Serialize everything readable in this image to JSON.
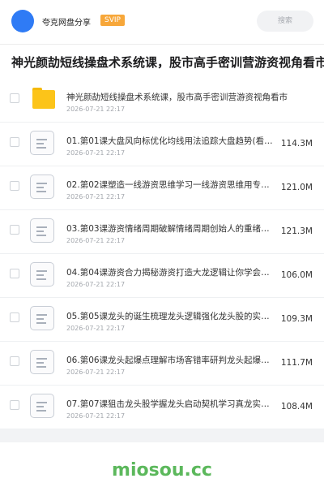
{
  "header": {
    "username": "夸克网盘分享",
    "badge": "SVIP",
    "search_placeholder": "搜索"
  },
  "page_title": "神光颜劼短线操盘术系统课，股市高手密训营游资视角看市",
  "items": [
    {
      "type": "folder",
      "name": "神光颜劼短线操盘术系统课，股市高手密训营游资视角看市",
      "date": "2026-07-21 22:17",
      "size": ""
    },
    {
      "type": "file",
      "name": "01.第01课大盘风向标优化均线用法追踪大盘趋势(看懂大盘风向)",
      "date": "2026-07-21 22:17",
      "size": "114.3M"
    },
    {
      "type": "file",
      "name": "02.第02课塑造一线游资思维学习一线游资思维用专业视角看盘",
      "date": "2026-07-21 22:17",
      "size": "121.0M"
    },
    {
      "type": "file",
      "name": "03.第03课游资情绪周期破解情绪周期创始人的重绪周期模型",
      "date": "2026-07-21 22:17",
      "size": "121.3M"
    },
    {
      "type": "file",
      "name": "04.第04课游资合力揭秘游资打造大龙逻辑让你学会跟随主力",
      "date": "2026-07-21 22:17",
      "size": "106.0M"
    },
    {
      "type": "file",
      "name": "05.第05课龙头的诞生梳理龙头逻辑强化龙头股的实战运用技巧",
      "date": "2026-07-21 22:17",
      "size": "109.3M"
    },
    {
      "type": "file",
      "name": "06.第06课龙头起爆点理解市场客错率研判龙头起爆信号",
      "date": "2026-07-21 22:17",
      "size": "111.7M"
    },
    {
      "type": "file",
      "name": "07.第07课狙击龙头股学握龙头启动契机学习真龙实战打法",
      "date": "2026-07-21 22:17",
      "size": "108.4M"
    }
  ],
  "footer": {
    "watermark": "miosou.cc"
  },
  "colors": {
    "accent": "#2f7bf5",
    "badge": "#f7a73a",
    "folder": "#fcc419",
    "watermark": "#5cb85c"
  }
}
